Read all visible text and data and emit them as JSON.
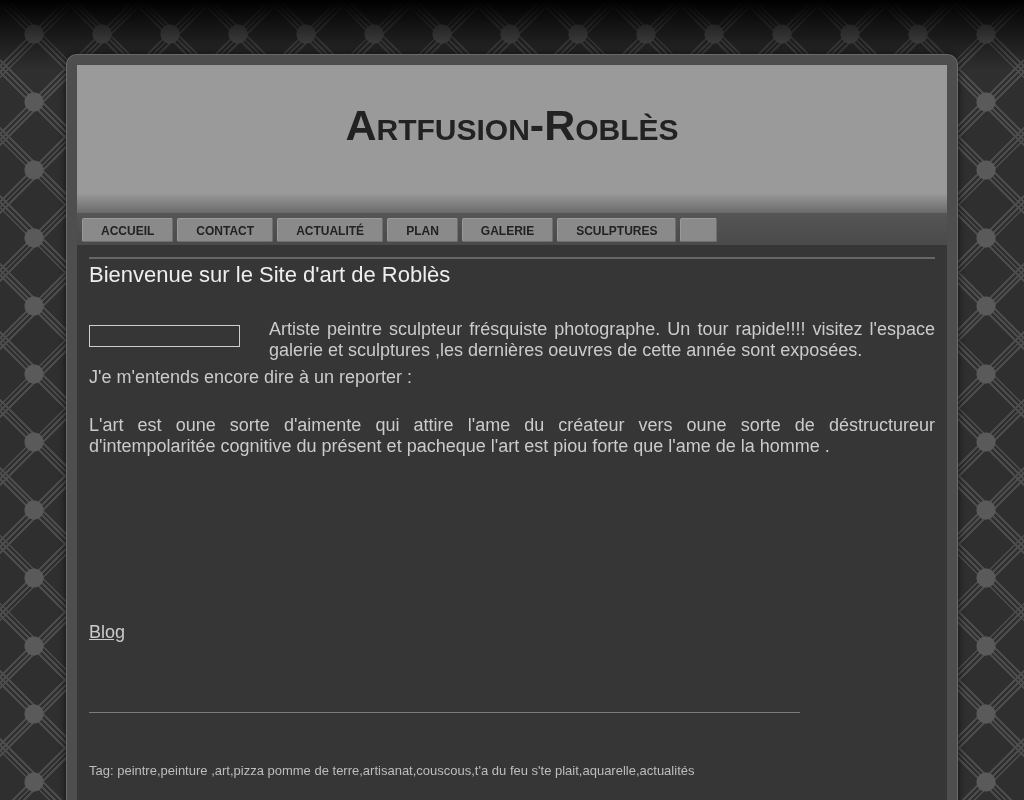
{
  "header": {
    "title": "Artfusion-Roblès"
  },
  "nav": {
    "items": [
      {
        "label": "ACCUEIL"
      },
      {
        "label": "CONTACT"
      },
      {
        "label": "ACTUALITÉ"
      },
      {
        "label": "PLAN"
      },
      {
        "label": "GALERIE"
      },
      {
        "label": "SCULPTURES"
      }
    ]
  },
  "content": {
    "heading": "Bienvenue sur le Site d'art de Roblès",
    "intro": "Artiste peintre sculpteur frésquiste photographe. Un tour rapide!!!! visitez l'espace galerie et sculptures ,les dernières oeuvres de cette année sont exposées.",
    "quote_intro": "J'e m'entends encore dire à un reporter :",
    "quote": "L'art est oune sorte d'aimente qui attire l'ame du créateur vers oune sorte de déstructureur d'intempolaritée cognitive du présent et pacheque l'art est piou forte que l'ame de la homme .",
    "blog_link": "Blog",
    "tags": "Tag: peintre,peinture ,art,pizza pomme de terre,artisanat,couscous,t'a du feu s'te plait,aquarelle,actualités"
  }
}
